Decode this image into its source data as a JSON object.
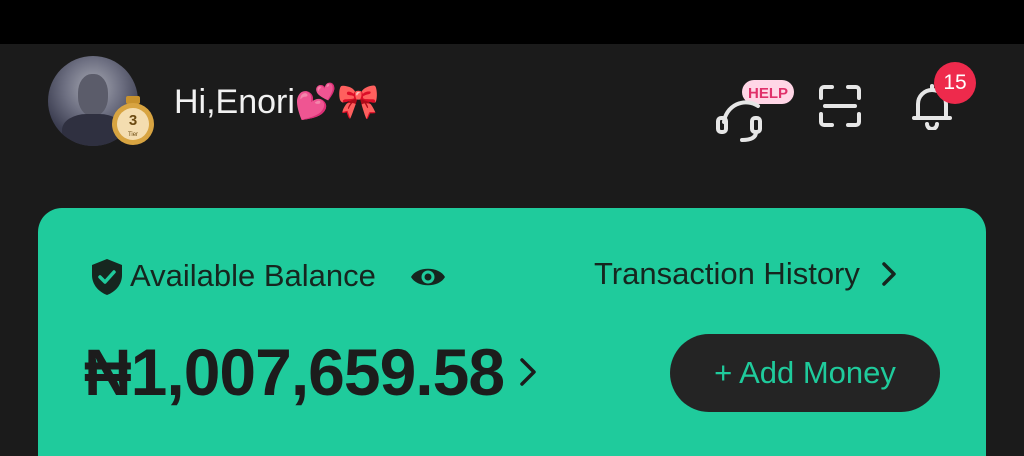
{
  "header": {
    "greeting": "Hi,Enori💕🎀",
    "tier_badge": "3",
    "tier_badge_caption": "Tier",
    "help_label": "HELP",
    "notification_count": "15"
  },
  "balance_card": {
    "label": "Available Balance",
    "transaction_history_label": "Transaction History",
    "amount": "₦1,007,659.58",
    "add_money_label": "+ Add Money",
    "card_color": "#1fcb9c"
  },
  "icons": {
    "visibility": "eye-icon",
    "security": "shield-check-icon",
    "support": "headset-icon",
    "scan": "scan-icon",
    "notifications": "bell-icon"
  }
}
